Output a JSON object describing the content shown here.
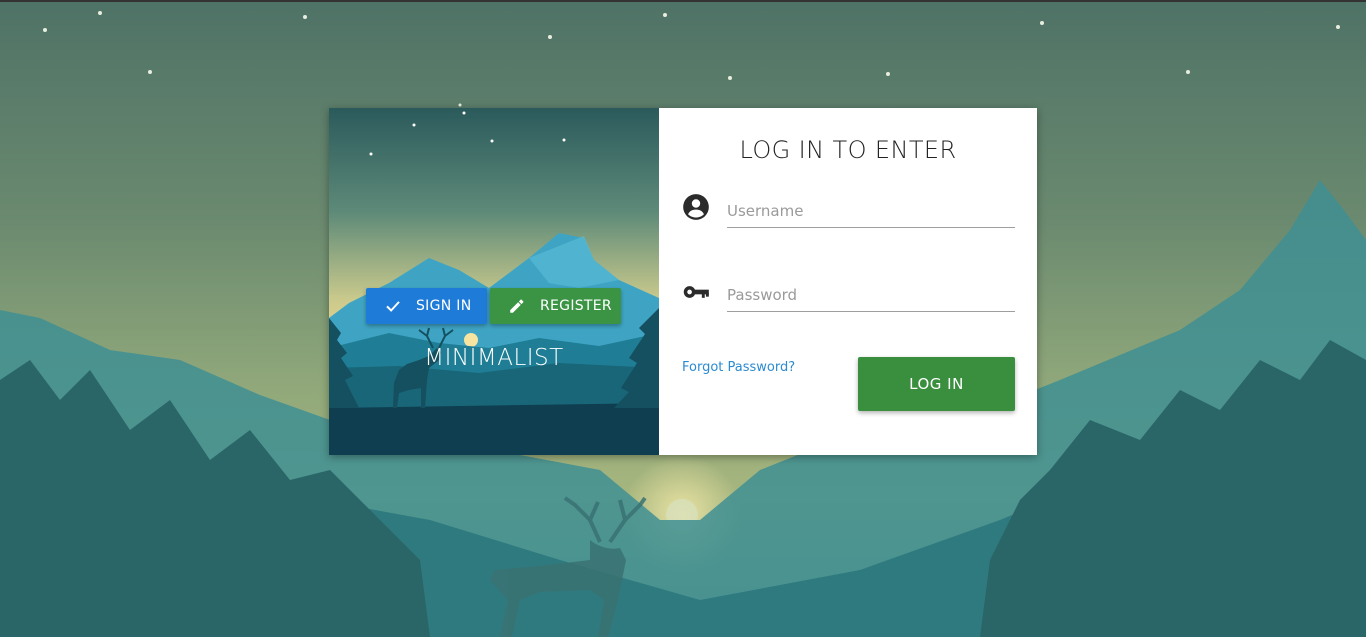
{
  "colors": {
    "sign_in_button": "#1f7bd8",
    "register_button": "#3a9444",
    "login_button": "#3a8f3f",
    "link": "#2b8bd1",
    "sky_top": "#2f5e5e",
    "sky_horizon": "#f0d68c",
    "mountain": "#2a9fbf"
  },
  "brand": {
    "title": "MINIMALIST",
    "sign_in_label": "SIGN IN",
    "register_label": "REGISTER",
    "sign_in_icon": "check-icon",
    "register_icon": "pencil-icon"
  },
  "login": {
    "title": "LOG IN TO ENTER",
    "username": {
      "placeholder": "Username",
      "value": "",
      "icon": "account-circle-icon"
    },
    "password": {
      "placeholder": "Password",
      "value": "",
      "icon": "key-icon"
    },
    "forgot_label": "Forgot Password?",
    "submit_label": "LOG IN"
  }
}
